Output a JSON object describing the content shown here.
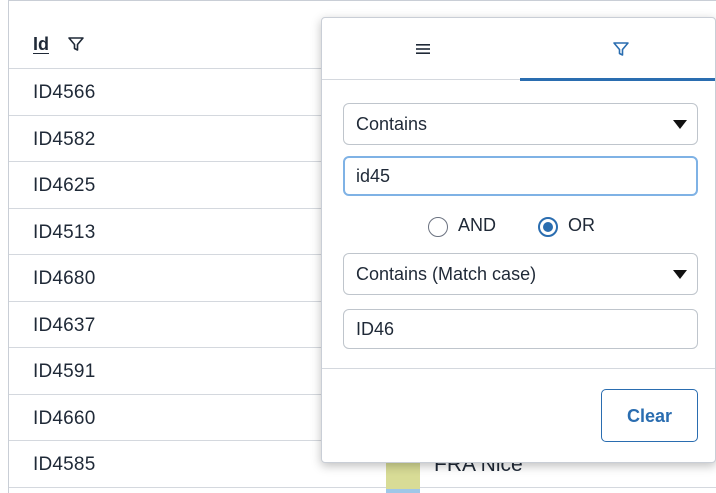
{
  "grid": {
    "column_header": {
      "label": "Id",
      "filter_icon": "filter-icon"
    },
    "rows": [
      "ID4566",
      "ID4582",
      "ID4625",
      "ID4513",
      "ID4680",
      "ID4637",
      "ID4591",
      "ID4660",
      "ID4585"
    ],
    "partial_city_cell": "FRA Nice"
  },
  "filter_panel": {
    "tabs": [
      {
        "name": "menu",
        "icon": "hamburger-menu-icon",
        "active": false
      },
      {
        "name": "filter",
        "icon": "filter-icon",
        "active": true
      }
    ],
    "condition1": {
      "operator": "Contains",
      "value": "id45"
    },
    "join": {
      "options": [
        "AND",
        "OR"
      ],
      "selected": "OR"
    },
    "condition2": {
      "operator": "Contains (Match case)",
      "value": "ID46"
    },
    "clear_label": "Clear"
  },
  "colors": {
    "accent": "#2a6db0",
    "focus_border": "#7fb2e5",
    "swatch": "#d8dc96"
  }
}
